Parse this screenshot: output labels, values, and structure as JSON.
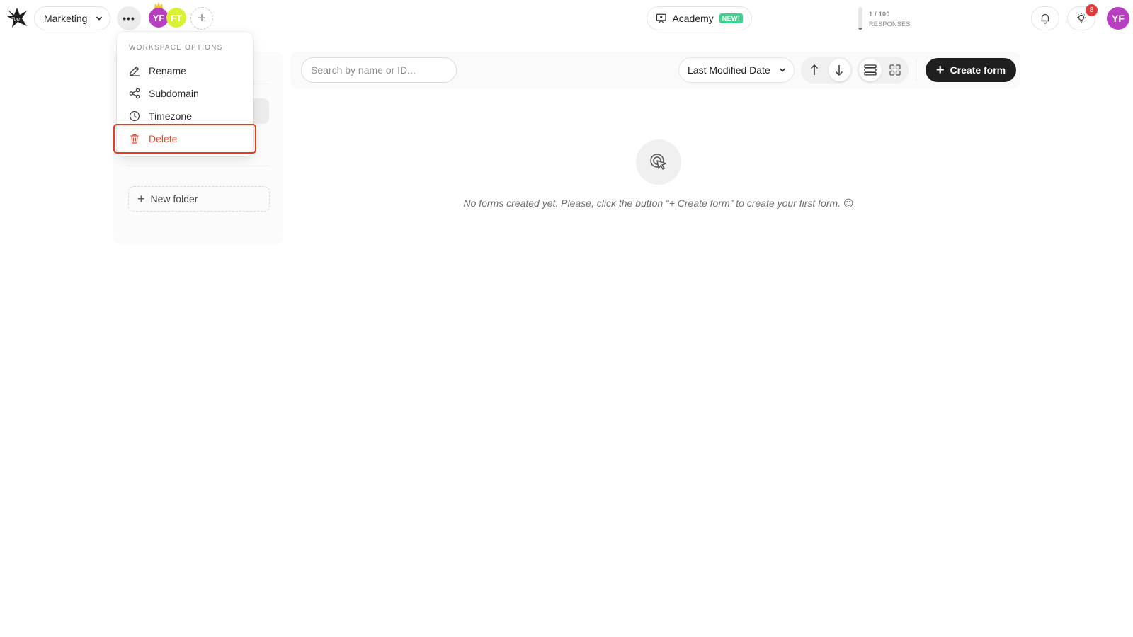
{
  "topbar": {
    "workspace_name": "Marketing",
    "more_label": "•••",
    "members": [
      "YF",
      "FT"
    ],
    "academy_label": "Academy",
    "academy_badge": "NEW!",
    "responses_count": "1 / 100",
    "responses_label": "RESPONSES",
    "responses_used_fraction": 0.01,
    "notification_count": "8",
    "user_initials": "YF"
  },
  "workspace_menu": {
    "title": "WORKSPACE OPTIONS",
    "items": [
      {
        "label": "Rename",
        "icon": "pencil-icon"
      },
      {
        "label": "Subdomain",
        "icon": "share-nodes-icon"
      },
      {
        "label": "Timezone",
        "icon": "clock-icon"
      },
      {
        "label": "Delete",
        "icon": "trash-icon"
      }
    ]
  },
  "sidebar": {
    "new_folder_label": "New folder"
  },
  "toolbar": {
    "search_placeholder": "Search by name or ID...",
    "sort_label": "Last Modified Date",
    "create_label": "Create form"
  },
  "empty_state": {
    "message": "No forms created yet. Please, click the button “+ Create form” to create your first form. 😉"
  },
  "colors": {
    "accent_dark": "#1f1f1f",
    "danger": "#e04b2f",
    "avatar_purple": "#b83ec2",
    "avatar_lime": "#d9f233",
    "new_badge": "#3fcf8e",
    "notification_badge": "#e33b3b"
  }
}
